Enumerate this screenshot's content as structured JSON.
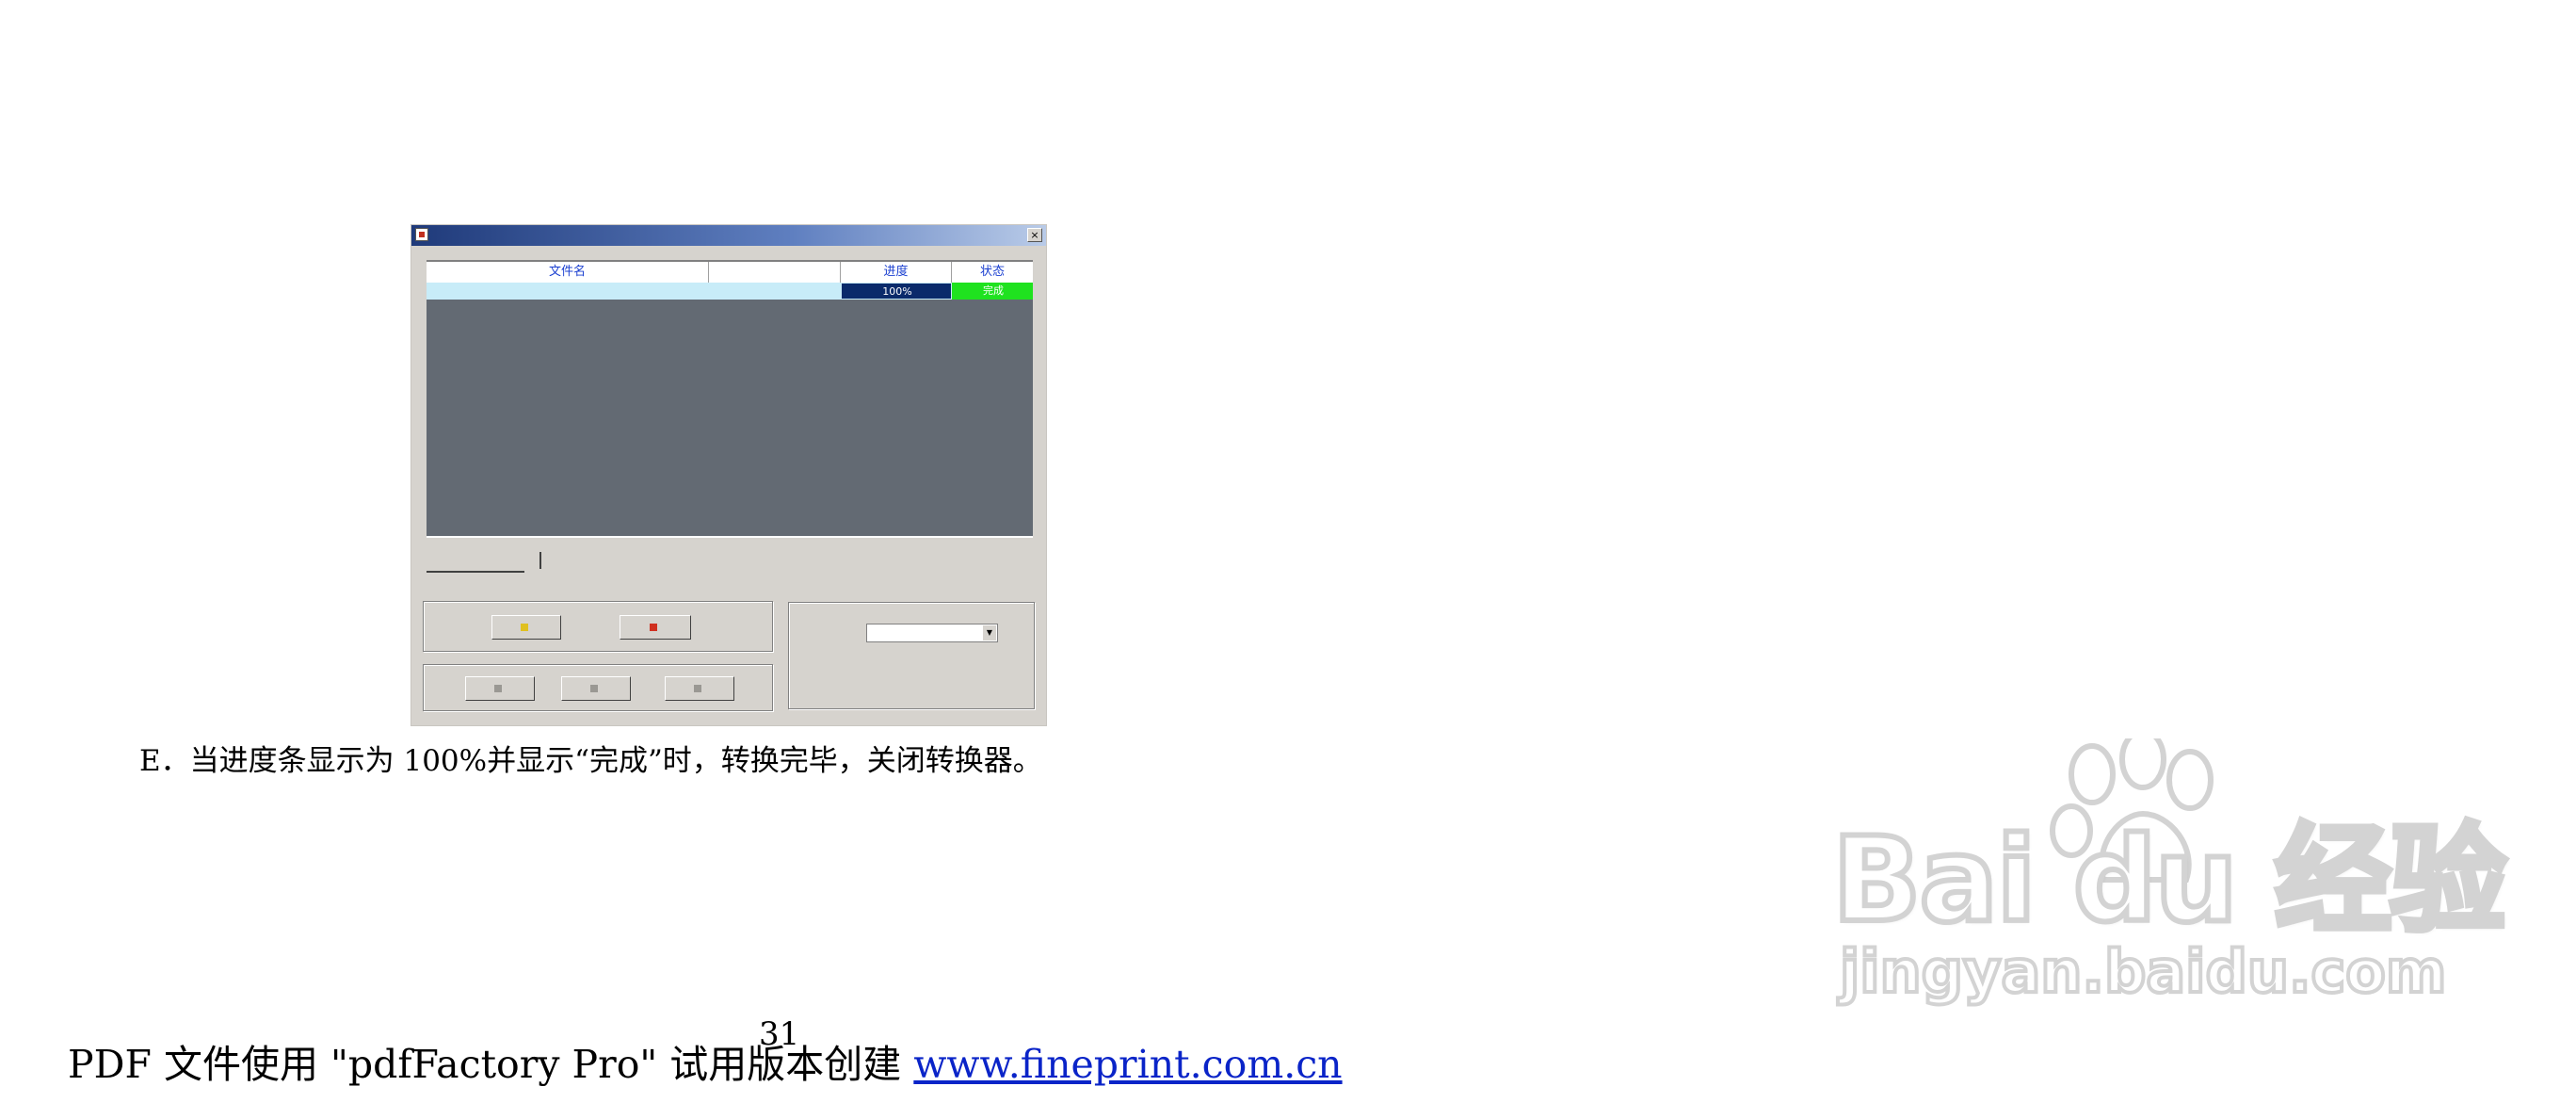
{
  "app_window": {
    "title": "",
    "close_glyph": "×",
    "list_headers": [
      "文件名",
      "",
      "进度",
      "状态"
    ],
    "row": {
      "filename": "",
      "size": "",
      "progress": "100%",
      "status": "完成"
    },
    "tabs": {
      "tab1": "",
      "tab2": ""
    },
    "group_left_top": {
      "label": ""
    },
    "group_left_bottom": {
      "label": ""
    },
    "group_right": {
      "label": "",
      "select_label": "",
      "select_value": ""
    },
    "buttons": {
      "start": "",
      "stop": "",
      "b1": "",
      "b2": "",
      "b3": ""
    }
  },
  "caption": "E．当进度条显示为 100%并显示“完成”时，转换完毕，关闭转换器。",
  "watermark": {
    "brand": "Bai du 经验",
    "url": "jingyan.baidu.com"
  },
  "footer": {
    "text": "PDF 文件使用 \"pdfFactory Pro\" 试用版本创建 ",
    "link": "www.fineprint.com.cn"
  },
  "page_number": "31",
  "colors": {
    "progress_fill": "#0a2a6a",
    "status_ok": "#1fe21f",
    "header_text": "#1a3fd0",
    "list_background": "#636a73",
    "link": "#0a24c8"
  }
}
